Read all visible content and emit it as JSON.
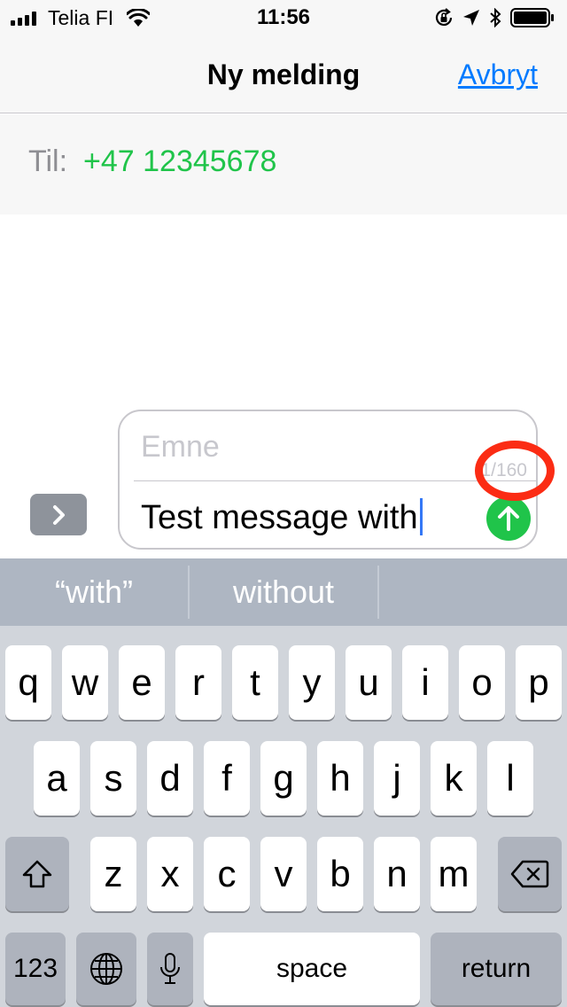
{
  "status_bar": {
    "carrier": "Telia FI",
    "time": "11:56",
    "signal_icon": "signal-bars-icon",
    "wifi_icon": "wifi-icon",
    "right_icons": [
      "orientation-lock-icon",
      "location-arrow-icon",
      "bluetooth-icon",
      "battery-icon"
    ]
  },
  "nav": {
    "title": "Ny melding",
    "cancel_label": "Avbryt",
    "accent_color": "#007aff"
  },
  "recipient": {
    "label": "Til:",
    "value": "+47 12345678",
    "color": "#20c44a"
  },
  "compose": {
    "subject_placeholder": "Emne",
    "subject_value": "",
    "char_count": "1/160",
    "message_text": "Test message with",
    "send_icon": "arrow-up-icon",
    "expand_icon": "chevron-right-icon"
  },
  "annotation": {
    "highlight_color": "#fb2c14"
  },
  "predictive": {
    "suggestions": [
      "“with”",
      "without",
      ""
    ]
  },
  "keyboard": {
    "row1": [
      "q",
      "w",
      "e",
      "r",
      "t",
      "y",
      "u",
      "i",
      "o",
      "p"
    ],
    "row2": [
      "a",
      "s",
      "d",
      "f",
      "g",
      "h",
      "j",
      "k",
      "l"
    ],
    "row3": [
      "z",
      "x",
      "c",
      "v",
      "b",
      "n",
      "m"
    ],
    "shift_icon": "shift-arrow-icon",
    "delete_icon": "delete-backspace-icon",
    "numbers_label": "123",
    "globe_icon": "globe-icon",
    "mic_icon": "microphone-icon",
    "space_label": "space",
    "return_label": "return"
  }
}
